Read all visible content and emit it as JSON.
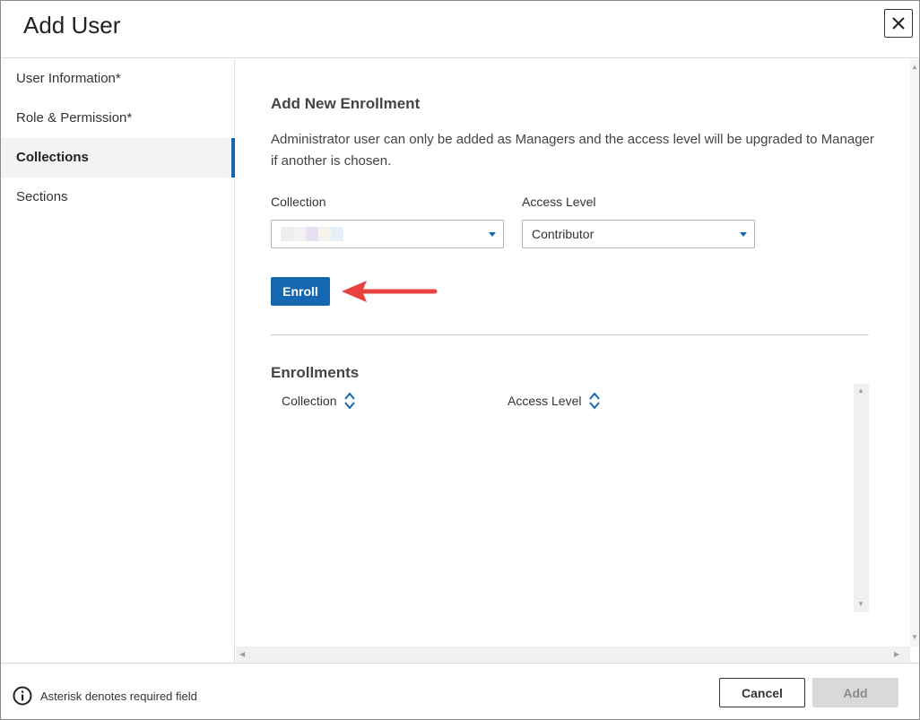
{
  "dialog": {
    "title": "Add User"
  },
  "sidebar": {
    "items": [
      {
        "label": "User Information*"
      },
      {
        "label": "Role & Permission*"
      },
      {
        "label": "Collections"
      },
      {
        "label": "Sections"
      }
    ],
    "active_index": 2
  },
  "main": {
    "section_title": "Add New Enrollment",
    "notice": "Administrator user can only be added as Managers and the access level will be upgraded to Manager if another is chosen.",
    "collection_label": "Collection",
    "access_label": "Access Level",
    "access_value": "Contributor",
    "enroll_button": "Enroll",
    "enrollments_title": "Enrollments",
    "columns": [
      {
        "label": "Collection"
      },
      {
        "label": "Access Level"
      }
    ]
  },
  "footer": {
    "required_note": "Asterisk denotes required field",
    "cancel_label": "Cancel",
    "add_label": "Add"
  },
  "colors": {
    "accent": "#1467b0",
    "arrow": "#e8423f",
    "disabled_bg": "#d9d9d9"
  },
  "icons": {
    "close": "close-icon",
    "info": "info-icon",
    "sort": "sort-icon",
    "annotation": "red-arrow-icon"
  }
}
